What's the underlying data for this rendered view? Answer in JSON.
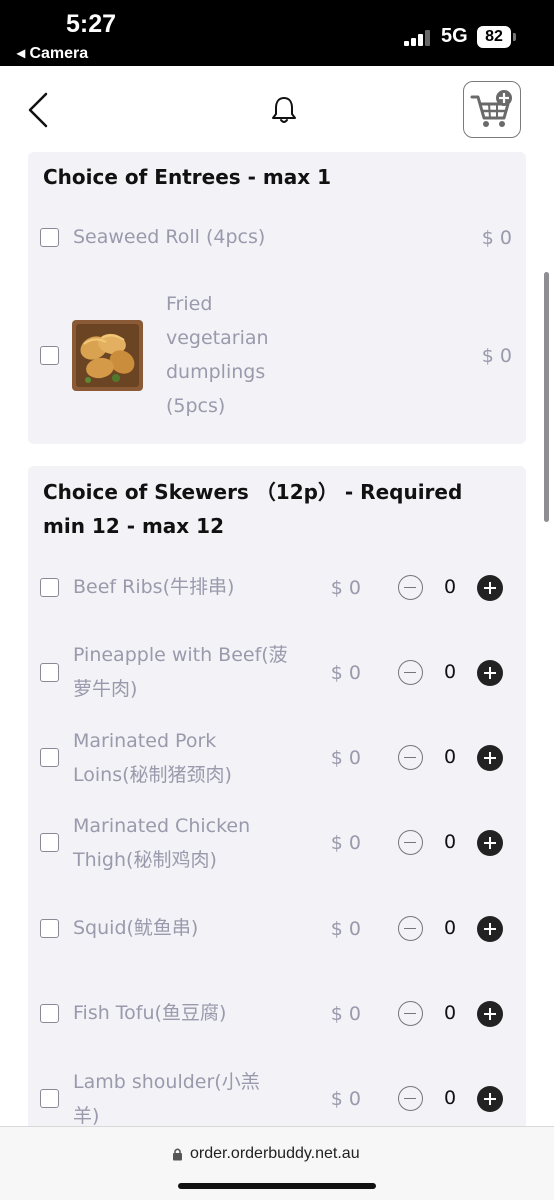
{
  "status_bar": {
    "time": "5:27",
    "back_app": "◂ Camera",
    "network": "5G",
    "battery": "82"
  },
  "entrees": {
    "title": "Choice of Entrees - max 1",
    "items": [
      {
        "name": "Seaweed Roll (4pcs)",
        "price": "$ 0"
      },
      {
        "name_lines": [
          "Fried",
          "vegetarian",
          "dumplings",
          "(5pcs)"
        ],
        "price": "$ 0"
      }
    ]
  },
  "skewers": {
    "title_line1": "Choice of Skewers （12p） - Required",
    "title_line2": "min 12 - max 12",
    "items": [
      {
        "name_lines": [
          "Beef Ribs(牛排串)"
        ],
        "price": "$ 0",
        "qty": "0"
      },
      {
        "name_lines": [
          "Pineapple with Beef(菠",
          "萝牛肉)"
        ],
        "price": "$ 0",
        "qty": "0"
      },
      {
        "name_lines": [
          "Marinated Pork",
          "Loins(秘制猪颈肉)"
        ],
        "price": "$ 0",
        "qty": "0"
      },
      {
        "name_lines": [
          "Marinated Chicken",
          "Thigh(秘制鸡肉)"
        ],
        "price": "$ 0",
        "qty": "0"
      },
      {
        "name_lines": [
          "Squid(鱿鱼串)"
        ],
        "price": "$ 0",
        "qty": "0"
      },
      {
        "name_lines": [
          "Fish Tofu(鱼豆腐)"
        ],
        "price": "$ 0",
        "qty": "0"
      },
      {
        "name_lines": [
          "Lamb shoulder(小羔",
          "羊)"
        ],
        "price": "$ 0",
        "qty": "0"
      }
    ]
  },
  "browser": {
    "url": "order.orderbuddy.net.au"
  }
}
